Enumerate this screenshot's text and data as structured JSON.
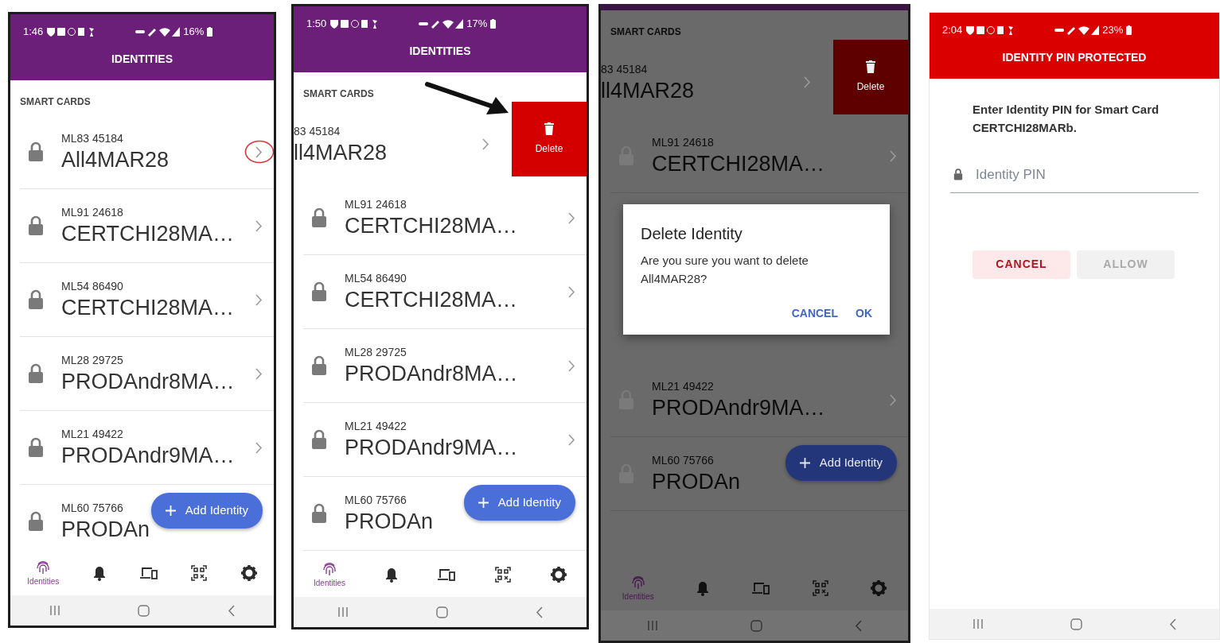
{
  "phones": [
    {
      "kind": "list",
      "status": {
        "time": "1:46",
        "battery": "16%"
      },
      "title": "IDENTITIES",
      "section": "SMART CARDS",
      "arrow": false,
      "rows": [
        {
          "number": "ML83 45184",
          "name": "All4MAR28",
          "swiped": false,
          "circled": true
        },
        {
          "number": "ML91 24618",
          "name": "CERTCHI28MA…",
          "swiped": false,
          "circled": false
        },
        {
          "number": "ML54 86490",
          "name": "CERTCHI28MA…",
          "swiped": false,
          "circled": false
        },
        {
          "number": "ML28 29725",
          "name": "PRODAndr8MA…",
          "swiped": false,
          "circled": false
        },
        {
          "number": "ML21 49422",
          "name": "PRODAndr9MA…",
          "swiped": false,
          "circled": false
        },
        {
          "number": "ML60 75766",
          "name": "PRODAn",
          "swiped": false,
          "circled": false
        }
      ],
      "fab": "Add Identity",
      "tabs": [
        {
          "kind": "fingerprint",
          "label": "Identities",
          "selected": true
        },
        {
          "kind": "bell",
          "selected": false
        },
        {
          "kind": "devices",
          "selected": false
        },
        {
          "kind": "qr",
          "selected": false
        },
        {
          "kind": "gear",
          "selected": false
        }
      ]
    },
    {
      "kind": "list",
      "status": {
        "time": "1:50",
        "battery": "17%"
      },
      "title": "IDENTITIES",
      "section": "SMART CARDS",
      "arrow": true,
      "rows": [
        {
          "number": "83 45184",
          "name": "ll4MAR28",
          "swiped": true,
          "action": "Delete",
          "circled": false
        },
        {
          "number": "ML91 24618",
          "name": "CERTCHI28MA…",
          "swiped": false,
          "circled": false
        },
        {
          "number": "ML54 86490",
          "name": "CERTCHI28MA…",
          "swiped": false,
          "circled": false
        },
        {
          "number": "ML28 29725",
          "name": "PRODAndr8MA…",
          "swiped": false,
          "circled": false
        },
        {
          "number": "ML21 49422",
          "name": "PRODAndr9MA…",
          "swiped": false,
          "circled": false
        },
        {
          "number": "ML60 75766",
          "name": "PRODAn",
          "swiped": false,
          "circled": false
        }
      ],
      "fab": "Add Identity",
      "tabs": [
        {
          "kind": "fingerprint",
          "label": "Identities",
          "selected": true
        },
        {
          "kind": "bell",
          "selected": false
        },
        {
          "kind": "devices",
          "selected": false
        },
        {
          "kind": "qr",
          "selected": false
        },
        {
          "kind": "gear",
          "selected": false
        }
      ]
    },
    {
      "kind": "list",
      "section": "SMART CARDS",
      "arrow": false,
      "rows": [
        {
          "number": "83 45184",
          "name": "ll4MAR28",
          "swiped": true,
          "action": "Delete",
          "circled": false
        },
        {
          "number": "ML91 24618",
          "name": "CERTCHI28MA…",
          "swiped": false,
          "circled": false
        }
      ],
      "dialog": {
        "title": "Delete Identity",
        "message": "Are you sure you want to delete All4MAR28?",
        "buttons": [
          "CANCEL",
          "OK"
        ]
      },
      "rows_below": [
        {
          "number": "ML21 49422",
          "name": "PRODAndr9MA…",
          "swiped": false,
          "circled": false
        },
        {
          "number": "ML60 75766",
          "name": "PRODAn",
          "swiped": false,
          "circled": false
        }
      ],
      "fab": "Add Identity",
      "tabs": [
        {
          "kind": "fingerprint",
          "label": "Identities",
          "selected": true
        },
        {
          "kind": "bell",
          "selected": false
        },
        {
          "kind": "devices",
          "selected": false
        },
        {
          "kind": "qr",
          "selected": false
        },
        {
          "kind": "gear",
          "selected": false
        }
      ]
    },
    {
      "kind": "pin",
      "status": {
        "time": "2:04",
        "battery": "23%"
      },
      "title": "IDENTITY PIN PROTECTED",
      "prompt": "Enter Identity PIN for Smart Card CERTCHI28MARb.",
      "field": {
        "placeholder": "Identity PIN"
      },
      "buttons": [
        {
          "label": "CANCEL",
          "disabled": false
        },
        {
          "label": "ALLOW",
          "disabled": true
        }
      ]
    }
  ]
}
